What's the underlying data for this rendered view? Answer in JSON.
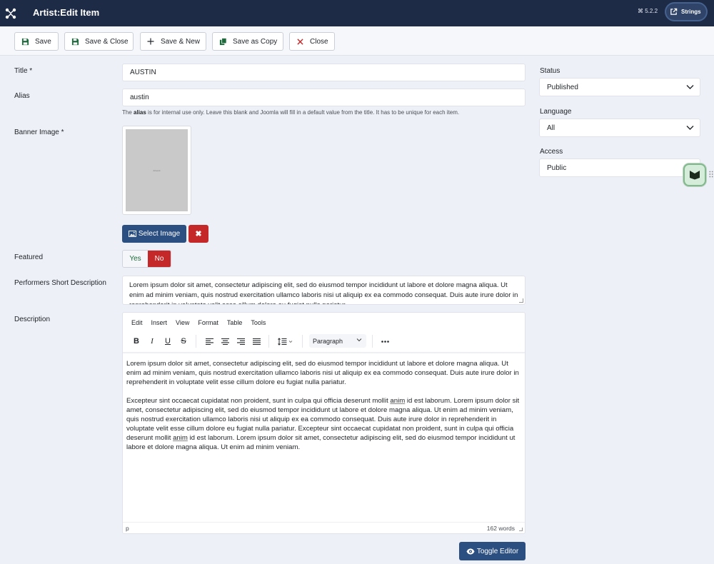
{
  "header": {
    "title": "Artist:Edit Item",
    "version": "⌘ 5.2.2",
    "strings_label": "Strings"
  },
  "toolbar": {
    "save": "Save",
    "save_close": "Save & Close",
    "save_new": "Save & New",
    "save_copy": "Save as Copy",
    "close": "Close"
  },
  "form": {
    "title_label": "Title *",
    "title_value": "AUSTIN",
    "alias_label": "Alias",
    "alias_value": "austin",
    "alias_hint_prefix": "The ",
    "alias_hint_bold": "alias",
    "alias_hint_rest": " is for internal use only. Leave this blank and Joomla will fill in a default value from the title. It has to be unique for each item.",
    "banner_label": "Banner Image *",
    "banner_placeholder_text": "Artwork",
    "select_image": "Select Image",
    "clear_image": "✖",
    "featured_label": "Featured",
    "featured_yes": "Yes",
    "featured_no": "No",
    "short_desc_label": "Performers Short Description",
    "short_desc_value": "Lorem ipsum dolor sit amet, consectetur adipiscing elit, sed do eiusmod tempor incididunt ut labore et dolore magna aliqua. Ut enim ad minim veniam, quis nostrud exercitation ullamco laboris nisi ut aliquip ex ea commodo consequat. Duis aute irure dolor in reprehenderit in voluptate velit esse cillum dolore eu fugiat nulla pariatur.",
    "description_label": "Description"
  },
  "editor": {
    "menu": [
      "Edit",
      "Insert",
      "View",
      "Format",
      "Table",
      "Tools"
    ],
    "block_format": "Paragraph",
    "para1": "Lorem ipsum dolor sit amet, consectetur adipiscing elit, sed do eiusmod tempor incididunt ut labore et dolore magna aliqua. Ut enim ad minim veniam, quis nostrud exercitation ullamco laboris nisi ut aliquip ex ea commodo consequat. Duis aute irure dolor in reprehenderit in voluptate velit esse cillum dolore eu fugiat nulla pariatur.",
    "para2_a": "Excepteur sint occaecat cupidatat non proident, sunt in culpa qui officia deserunt mollit ",
    "para2_anim1": "anim",
    "para2_b": " id est laborum. Lorem ipsum dolor sit amet, consectetur adipiscing elit, sed do eiusmod tempor incididunt ut labore et dolore magna aliqua. Ut enim ad minim veniam, quis nostrud exercitation ullamco laboris nisi ut aliquip ex ea commodo consequat. Duis aute irure dolor in reprehenderit in voluptate velit esse cillum dolore eu fugiat nulla pariatur. Excepteur sint occaecat cupidatat non proident, sunt in culpa qui officia deserunt mollit ",
    "para2_anim2": "anim",
    "para2_c": " id est laborum. Lorem ipsum dolor sit amet, consectetur adipiscing elit, sed do eiusmod tempor incididunt ut labore et dolore magna aliqua. Ut enim ad minim veniam.",
    "status_path": "p",
    "word_count": "162 words",
    "toggle_label": "Toggle Editor"
  },
  "sidebar": {
    "status_label": "Status",
    "status_value": "Published",
    "language_label": "Language",
    "language_value": "All",
    "access_label": "Access",
    "access_value": "Public"
  },
  "colors": {
    "header_bg": "#1d2b47",
    "primary": "#2b4f80",
    "danger": "#c52828",
    "success_text": "#1e6a3c"
  }
}
